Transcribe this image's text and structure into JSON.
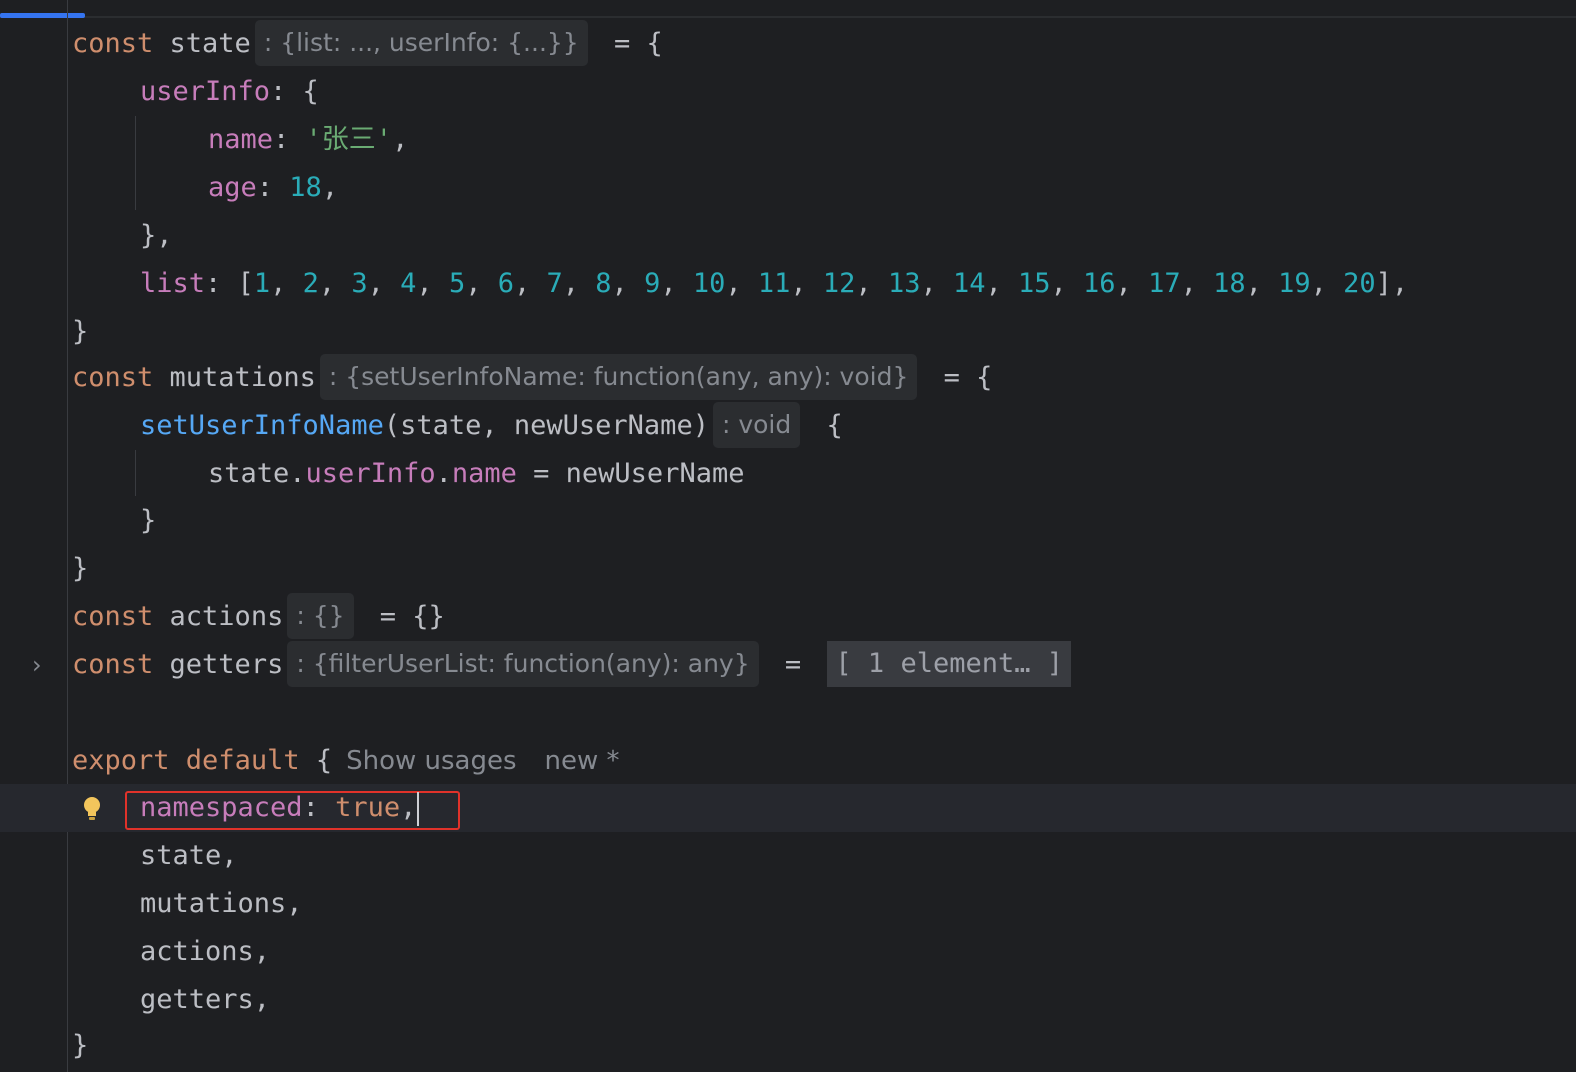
{
  "editor": {
    "lines": {
      "l1": {
        "kw": "const",
        "name": " state",
        "hint": ": {list: ..., userInfo: {...}}",
        "rest": " = {"
      },
      "l2": {
        "prop": "userInfo",
        "rest": ": {"
      },
      "l3": {
        "prop": "name",
        "colon": ": ",
        "str": "'张三'",
        "rest": ","
      },
      "l4": {
        "prop": "age",
        "colon": ": ",
        "num": "18",
        "rest": ","
      },
      "l5": {
        "text": "},"
      },
      "l6": {
        "prop": "list",
        "rest": ": [",
        "items": [
          "1",
          "2",
          "3",
          "4",
          "5",
          "6",
          "7",
          "8",
          "9",
          "10",
          "11",
          "12",
          "13",
          "14",
          "15",
          "16",
          "17",
          "18",
          "19",
          "20"
        ],
        "end": "],"
      },
      "l7": {
        "text": "}"
      },
      "l8": {
        "kw": "const",
        "name": " mutations",
        "hint": ": {setUserInfoName: function(any, any): void}",
        "rest": " = {"
      },
      "l9": {
        "fn": "setUserInfoName",
        "args": "(state, newUserName)",
        "hint": ": void",
        "rest": " {"
      },
      "l10": {
        "obj": "state.",
        "prop1": "userInfo",
        "dot": ".",
        "prop2": "name",
        "rest": " = newUserName"
      },
      "l11": {
        "text": "}"
      },
      "l12": {
        "text": "}"
      },
      "l13": {
        "kw": "const",
        "name": " actions",
        "hint": ": {}",
        "rest": " = {}"
      },
      "l14": {
        "kw": "const",
        "name": " getters",
        "hint": ": {filterUserList: function(any): any}",
        "rest": " = ",
        "fold": "[ 1 element… ]"
      },
      "l16": {
        "kw1": "export",
        "kw2": " default",
        "rest": " {",
        "usage1": "Show usages",
        "usage2": "new *"
      },
      "l17": {
        "prop": "namespaced",
        "colon": ": ",
        "kw": "true",
        "rest": ","
      },
      "l18": {
        "text": "state,"
      },
      "l19": {
        "text": "mutations,"
      },
      "l20": {
        "text": "actions,"
      },
      "l21": {
        "text": "getters,"
      },
      "l22": {
        "text": "}"
      }
    },
    "colors": {
      "background": "#1e1f22",
      "keyword": "#cf8e6d",
      "property": "#c77dbb",
      "number": "#2aacb8",
      "string": "#6aab73",
      "function": "#56a8f5",
      "highlight_border": "#e0322a"
    },
    "icons": {
      "fold": "chevron-right-icon",
      "intention": "lightbulb-icon"
    }
  }
}
